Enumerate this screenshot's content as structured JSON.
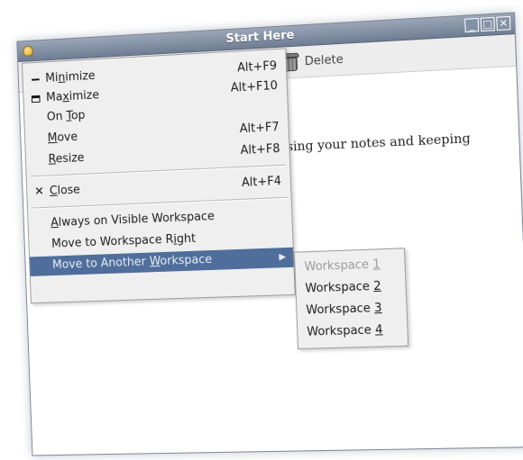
{
  "window": {
    "title": "Start Here"
  },
  "toolbar": {
    "delete_label": "Delete"
  },
  "content": {
    "visible_text": "ising your notes and keeping"
  },
  "menu": {
    "items": [
      {
        "label": "Minimize",
        "accel": "Alt+F9",
        "glyph": "minimize-icon"
      },
      {
        "label": "Maximize",
        "accel": "Alt+F10",
        "glyph": "maximize-icon"
      },
      {
        "label": "On Top",
        "accel": ""
      },
      {
        "label": "Move",
        "accel": "Alt+F7"
      },
      {
        "label": "Resize",
        "accel": "Alt+F8"
      },
      {
        "label": "Close",
        "accel": "Alt+F4",
        "glyph": "close-icon"
      },
      {
        "label": "Always on Visible Workspace",
        "accel": ""
      },
      {
        "label": "Move to Workspace Right",
        "accel": ""
      },
      {
        "label": "Move to Another Workspace",
        "accel": "",
        "selected": true
      }
    ]
  },
  "submenu": {
    "items": [
      {
        "label": "Workspace 1",
        "disabled": true
      },
      {
        "label": "Workspace 2"
      },
      {
        "label": "Workspace 3"
      },
      {
        "label": "Workspace 4"
      }
    ]
  },
  "colors": {
    "selection": "#4f6e9b",
    "titlebar": "#7d8aa0",
    "menu_bg": "#efefef"
  }
}
